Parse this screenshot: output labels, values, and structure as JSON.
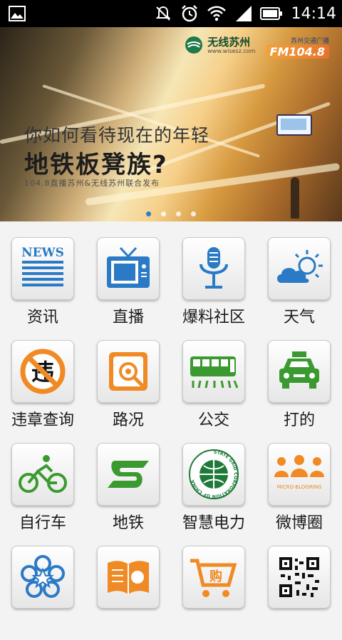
{
  "status_bar": {
    "time": "14:14",
    "icons": [
      "image-icon",
      "mute-icon",
      "alarm-icon",
      "wifi-icon",
      "signal-icon",
      "battery-icon"
    ]
  },
  "banner": {
    "logo_name": "无线苏州",
    "logo_url": "www.wisesz.com",
    "radio_name": "苏州交通广播",
    "radio_freq": "FM104.8",
    "headline_1": "你如何看待现在的年轻",
    "headline_2": "地铁板凳族?",
    "subline": "104.8直播苏州&无线苏州联合发布",
    "pages": 4,
    "active_page": 0
  },
  "grid": {
    "items": [
      {
        "label": "资讯",
        "icon": "news-icon"
      },
      {
        "label": "直播",
        "icon": "tv-icon"
      },
      {
        "label": "爆料社区",
        "icon": "microphone-icon"
      },
      {
        "label": "天气",
        "icon": "weather-icon"
      },
      {
        "label": "违章查询",
        "icon": "no-traffic-icon"
      },
      {
        "label": "路况",
        "icon": "road-condition-icon"
      },
      {
        "label": "公交",
        "icon": "bus-icon"
      },
      {
        "label": "打的",
        "icon": "taxi-icon"
      },
      {
        "label": "自行车",
        "icon": "bicycle-icon"
      },
      {
        "label": "地铁",
        "icon": "metro-icon"
      },
      {
        "label": "智慧电力",
        "icon": "power-grid-icon"
      },
      {
        "label": "微博圈",
        "icon": "weibo-circle-icon"
      },
      {
        "label": "",
        "icon": "star-flower-icon"
      },
      {
        "label": "",
        "icon": "book-icon"
      },
      {
        "label": "",
        "icon": "shopping-cart-icon"
      },
      {
        "label": "",
        "icon": "qr-code-icon"
      }
    ],
    "icon_text": {
      "news": "NEWS",
      "power_grid_ring": "STATE GRID CORPORATION OF CHINA",
      "weibo": "MICRO-BLOGRING",
      "taboo_char": "违",
      "cart_char": "购"
    }
  },
  "colors": {
    "blue": "#2a7ac6",
    "orange": "#f08a24",
    "green": "#3a9a2f"
  }
}
